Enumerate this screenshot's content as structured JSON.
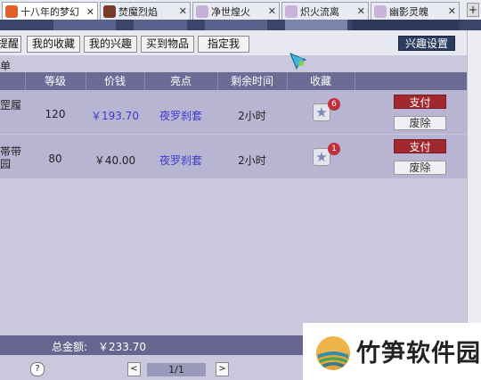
{
  "tabs": [
    {
      "label": "十八年的梦幻",
      "active": true
    },
    {
      "label": "焚魔烈焰",
      "active": false
    },
    {
      "label": "净世煌火",
      "active": false
    },
    {
      "label": "炽火流离",
      "active": false
    },
    {
      "label": "幽影灵魄",
      "active": false
    }
  ],
  "nav": {
    "buttons": [
      "提醒",
      "我的收藏",
      "我的兴趣",
      "买到物品",
      "指定我"
    ],
    "interest_settings": "兴趣设置",
    "crumb": "单"
  },
  "table": {
    "headers": [
      "等级",
      "价钱",
      "亮点",
      "剩余时间",
      "收藏"
    ],
    "rows": [
      {
        "name": [
          "罡履"
        ],
        "level": "120",
        "price": "￥193.70",
        "highlight": "夜罗刹套",
        "remaining": "2小时",
        "fav_count": "6",
        "pay": "支付",
        "delete": "废除"
      },
      {
        "name": [
          "帯带",
          "园"
        ],
        "level": "80",
        "price": "￥40.00",
        "highlight": "夜罗刹套",
        "remaining": "2小时",
        "fav_count": "1",
        "pay": "支付",
        "delete": "废除"
      }
    ]
  },
  "footer": {
    "total_label": "总金额:",
    "total_value": "￥233.70",
    "help": "?",
    "page": "1/1",
    "prev": "<",
    "next": ">"
  },
  "watermark": {
    "text": "竹笋软件园"
  },
  "colors": {
    "pay": "#a1282e",
    "header": "#6b6b96",
    "row": "#b7b5d2",
    "link": "#3b3bcc"
  }
}
